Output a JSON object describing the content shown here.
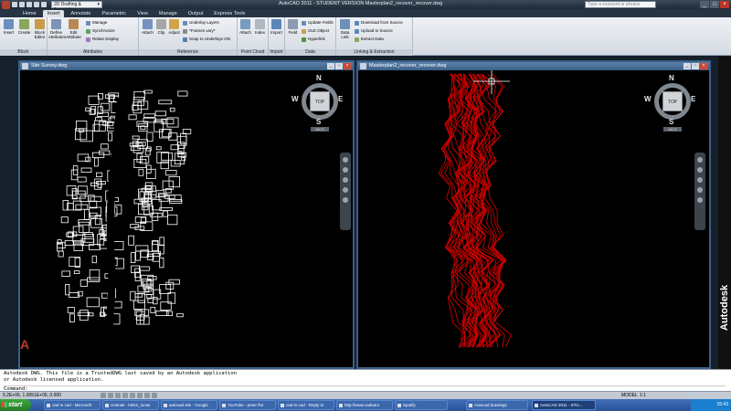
{
  "titlebar": {
    "workspace": "2D Drafting & Annotation",
    "title": "AutoCAD 2011 - STUDENT VERSION   Masterplan2_recover_recover.dwg",
    "search_placeholder": "Type a keyword or phrase"
  },
  "tabs": [
    "Home",
    "Insert",
    "Annotate",
    "Parametric",
    "View",
    "Manage",
    "Output",
    "Express Tools"
  ],
  "active_tab": "Insert",
  "ribbon": {
    "block": {
      "title": "Block",
      "buttons": [
        "Insert",
        "Create",
        "Block Editor"
      ]
    },
    "attributes": {
      "title": "Attributes",
      "big": [
        "Define Attributes",
        "Edit Attribute"
      ],
      "small": [
        "Manage",
        "Synchronize",
        "Retain Display"
      ]
    },
    "reference": {
      "title": "Reference",
      "big": [
        "Attach",
        "Clip",
        "Adjust"
      ],
      "small": [
        "Underlay Layers",
        "*Frames vary*",
        "Snap to Underlays ON"
      ]
    },
    "point_cloud": {
      "title": "Point Cloud",
      "big": [
        "Attach",
        "Index"
      ]
    },
    "import": {
      "title": "Import",
      "big": [
        "Import"
      ]
    },
    "data": {
      "title": "Data",
      "big": [
        "Field"
      ],
      "small": [
        "Update Fields",
        "OLE Object",
        "Hyperlink"
      ]
    },
    "linking": {
      "title": "Linking & Extraction",
      "big": [
        "Data Link"
      ],
      "small": [
        "Download from Source",
        "Upload to Source",
        "Extract Data"
      ]
    }
  },
  "windows": {
    "left": {
      "title": "Site Survey.dwg"
    },
    "right": {
      "title": "Masterplan2_recover_recover.dwg"
    }
  },
  "viewcube": {
    "face": "TOP",
    "n": "N",
    "s": "S",
    "e": "E",
    "w": "W",
    "wcs": "WCS"
  },
  "brand": "Autodesk",
  "cmd": {
    "line1": "Autodesk DWG.  This file is a TrustedDWG last saved by an Autodesk application",
    "line2": "or Autodesk licensed application.",
    "prompt": "Command:"
  },
  "status": {
    "coords": "5.2E+06, 1.0051E+06, 0.000",
    "model": "MODEL",
    "scale": "1:1"
  },
  "taskbar": {
    "start": "start",
    "tasks": [
      "cad to cad - Microsoft",
      "Hotmail - helen_lucas",
      "autocad site - Google",
      "YouTube - peter flor",
      "cad to cad - Reply to",
      "http://www.cadtutor",
      "Spotify",
      "Autocad drawings",
      "AutoCAD 2011 - STU..."
    ],
    "clock": "15:43"
  },
  "colors": {
    "drawing_bg": "#000000",
    "contour_red": "#c80000",
    "survey_white": "#ffffff",
    "window_frame": "#3b5f86"
  }
}
